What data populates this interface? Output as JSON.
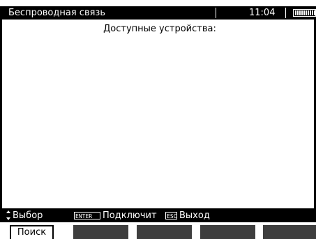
{
  "status_bar": {
    "title": "Беспроводная связь",
    "time": "11:04",
    "battery_icon": "battery-full-icon"
  },
  "main": {
    "heading": "Доступные устройства:"
  },
  "hint_bar": {
    "select_label": "Выбор",
    "enter_key": "ENTER",
    "connect_label": "Подключит",
    "esc_key": "ESC",
    "exit_label": "Выход"
  },
  "softkeys": {
    "search_label": "Поиск"
  },
  "colors": {
    "bar_background": "#000000",
    "bar_text": "#ffffff",
    "softkey_empty": "#3e3e3e"
  }
}
